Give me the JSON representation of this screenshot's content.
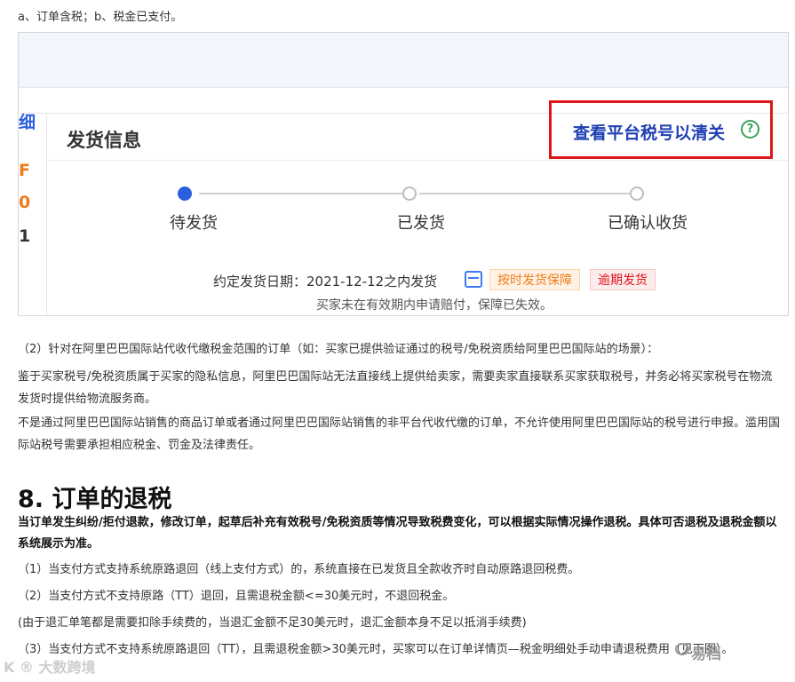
{
  "intro": "a、订单含税；b、税金已支付。",
  "embedded": {
    "left_glyphs": [
      "细",
      "F",
      "0",
      "1"
    ],
    "ship_title": "发货信息",
    "check_link": "查看平台税号以清关",
    "help_icon": "?",
    "steps": [
      "待发货",
      "已发货",
      "已确认收货"
    ],
    "deadline": "约定发货日期：2021-12-12之内发货",
    "badge_ontime": "按时发货保障",
    "badge_late": "逾期发货",
    "expired_note": "买家未在有效期内申请赔付，保障已失效。",
    "accent_blue": "#2c5fe0",
    "highlight_red": "#e0141a"
  },
  "paras": {
    "p2_title": "（2）针对在阿里巴巴国际站代收代缴税金范围的订单（如：买家已提供验证通过的税号/免税资质给阿里巴巴国际站的场景）：",
    "p2_body": "鉴于买家税号/免税资质属于买家的隐私信息，阿里巴巴国际站无法直接线上提供给卖家，需要卖家直接联系买家获取税号，并务必将买家税号在物流发货时提供给物流服务商。",
    "p3_body": "不是通过阿里巴巴国际站销售的商品订单或者通过阿里巴巴国际站销售的非平台代收代缴的订单，不允许使用阿里巴巴国际站的税号进行申报。滥用国际站税号需要承担相应税金、罚金及法律责任。"
  },
  "section": {
    "title": "8. 订单的退税",
    "lead": "当订单发生纠纷/拒付退款，修改订单，起草后补充有效税号/免税资质等情况导致税费变化，可以根据实际情况操作退税。具体可否退税及退税金额以系统展示为准。",
    "item1": "（1）当支付方式支持系统原路退回（线上支付方式）的，系统直接在已发货且全款收齐时自动原路退回税费。",
    "item2": "（2）当支付方式不支持原路（TT）退回，且需退税金额<=30美元时，不退回税金。",
    "note": "(由于退汇单笔都是需要扣除手续费的，当退汇金额不足30美元时，退汇金额本身不足以抵消手续费)",
    "item3": "（3）当支付方式不支持系统原路退回（TT），且需退税金额>30美元时，买家可以在订单详情页—税金明细处手动申请退税费用（见下图）。"
  },
  "watermarks": {
    "left": "K ® 大数跨境",
    "right": "易档"
  }
}
